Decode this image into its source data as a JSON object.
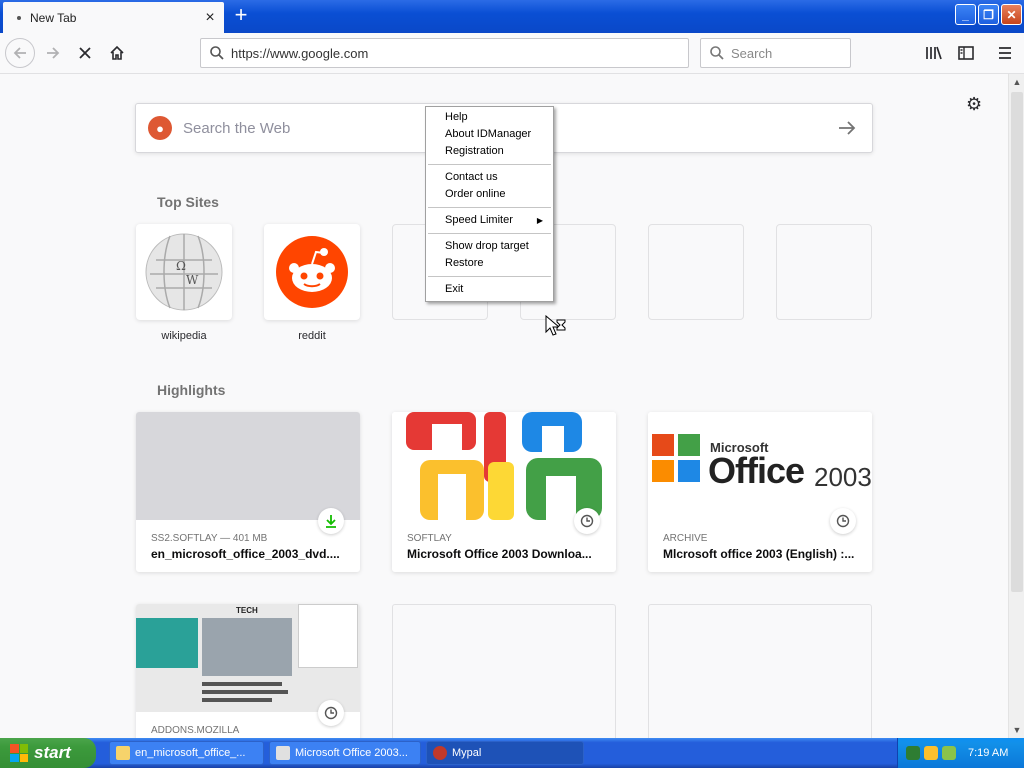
{
  "browser": {
    "tab_title": "New Tab",
    "tab_close": "×",
    "new_tab": "+",
    "url": "https://www.google.com",
    "search_placeholder": "Search"
  },
  "newtab": {
    "web_search_placeholder": "Search the Web",
    "top_sites_title": "Top Sites",
    "top_sites": [
      {
        "label": "wikipedia"
      },
      {
        "label": "reddit"
      }
    ],
    "highlights_title": "Highlights",
    "highlights": [
      {
        "meta": "SS2.SOFTLAY — 401 MB",
        "title": "en_microsoft_office_2003_dvd...."
      },
      {
        "meta": "SOFTLAY",
        "title": "Microsoft Office 2003 Downloa..."
      },
      {
        "meta": "ARCHIVE",
        "title": "Mlcrosoft office 2003 (English) :..."
      },
      {
        "meta": "ADDONS.MOZILLA",
        "title": ""
      }
    ],
    "office_logo_text": "Microsoft",
    "office_logo_big": "Office",
    "office_logo_year": "2003",
    "tech_text": "TECH"
  },
  "context_menu": {
    "group1": [
      "Help",
      "About IDManager",
      "Registration"
    ],
    "group2": [
      "Contact us",
      "Order online"
    ],
    "group3": [
      "Speed Limiter"
    ],
    "group4": [
      "Show drop target",
      "Restore"
    ],
    "group5": [
      "Exit"
    ]
  },
  "taskbar": {
    "start_label": "start",
    "tasks": [
      {
        "label": "en_microsoft_office_..."
      },
      {
        "label": "Microsoft Office 2003..."
      },
      {
        "label": "Mypal"
      }
    ],
    "clock": "7:19 AM"
  },
  "colors": {
    "xp_blue": "#245edb",
    "start_green": "#3c9a3c",
    "reddit_orange": "#ff4500",
    "download_green": "#12bc00"
  }
}
